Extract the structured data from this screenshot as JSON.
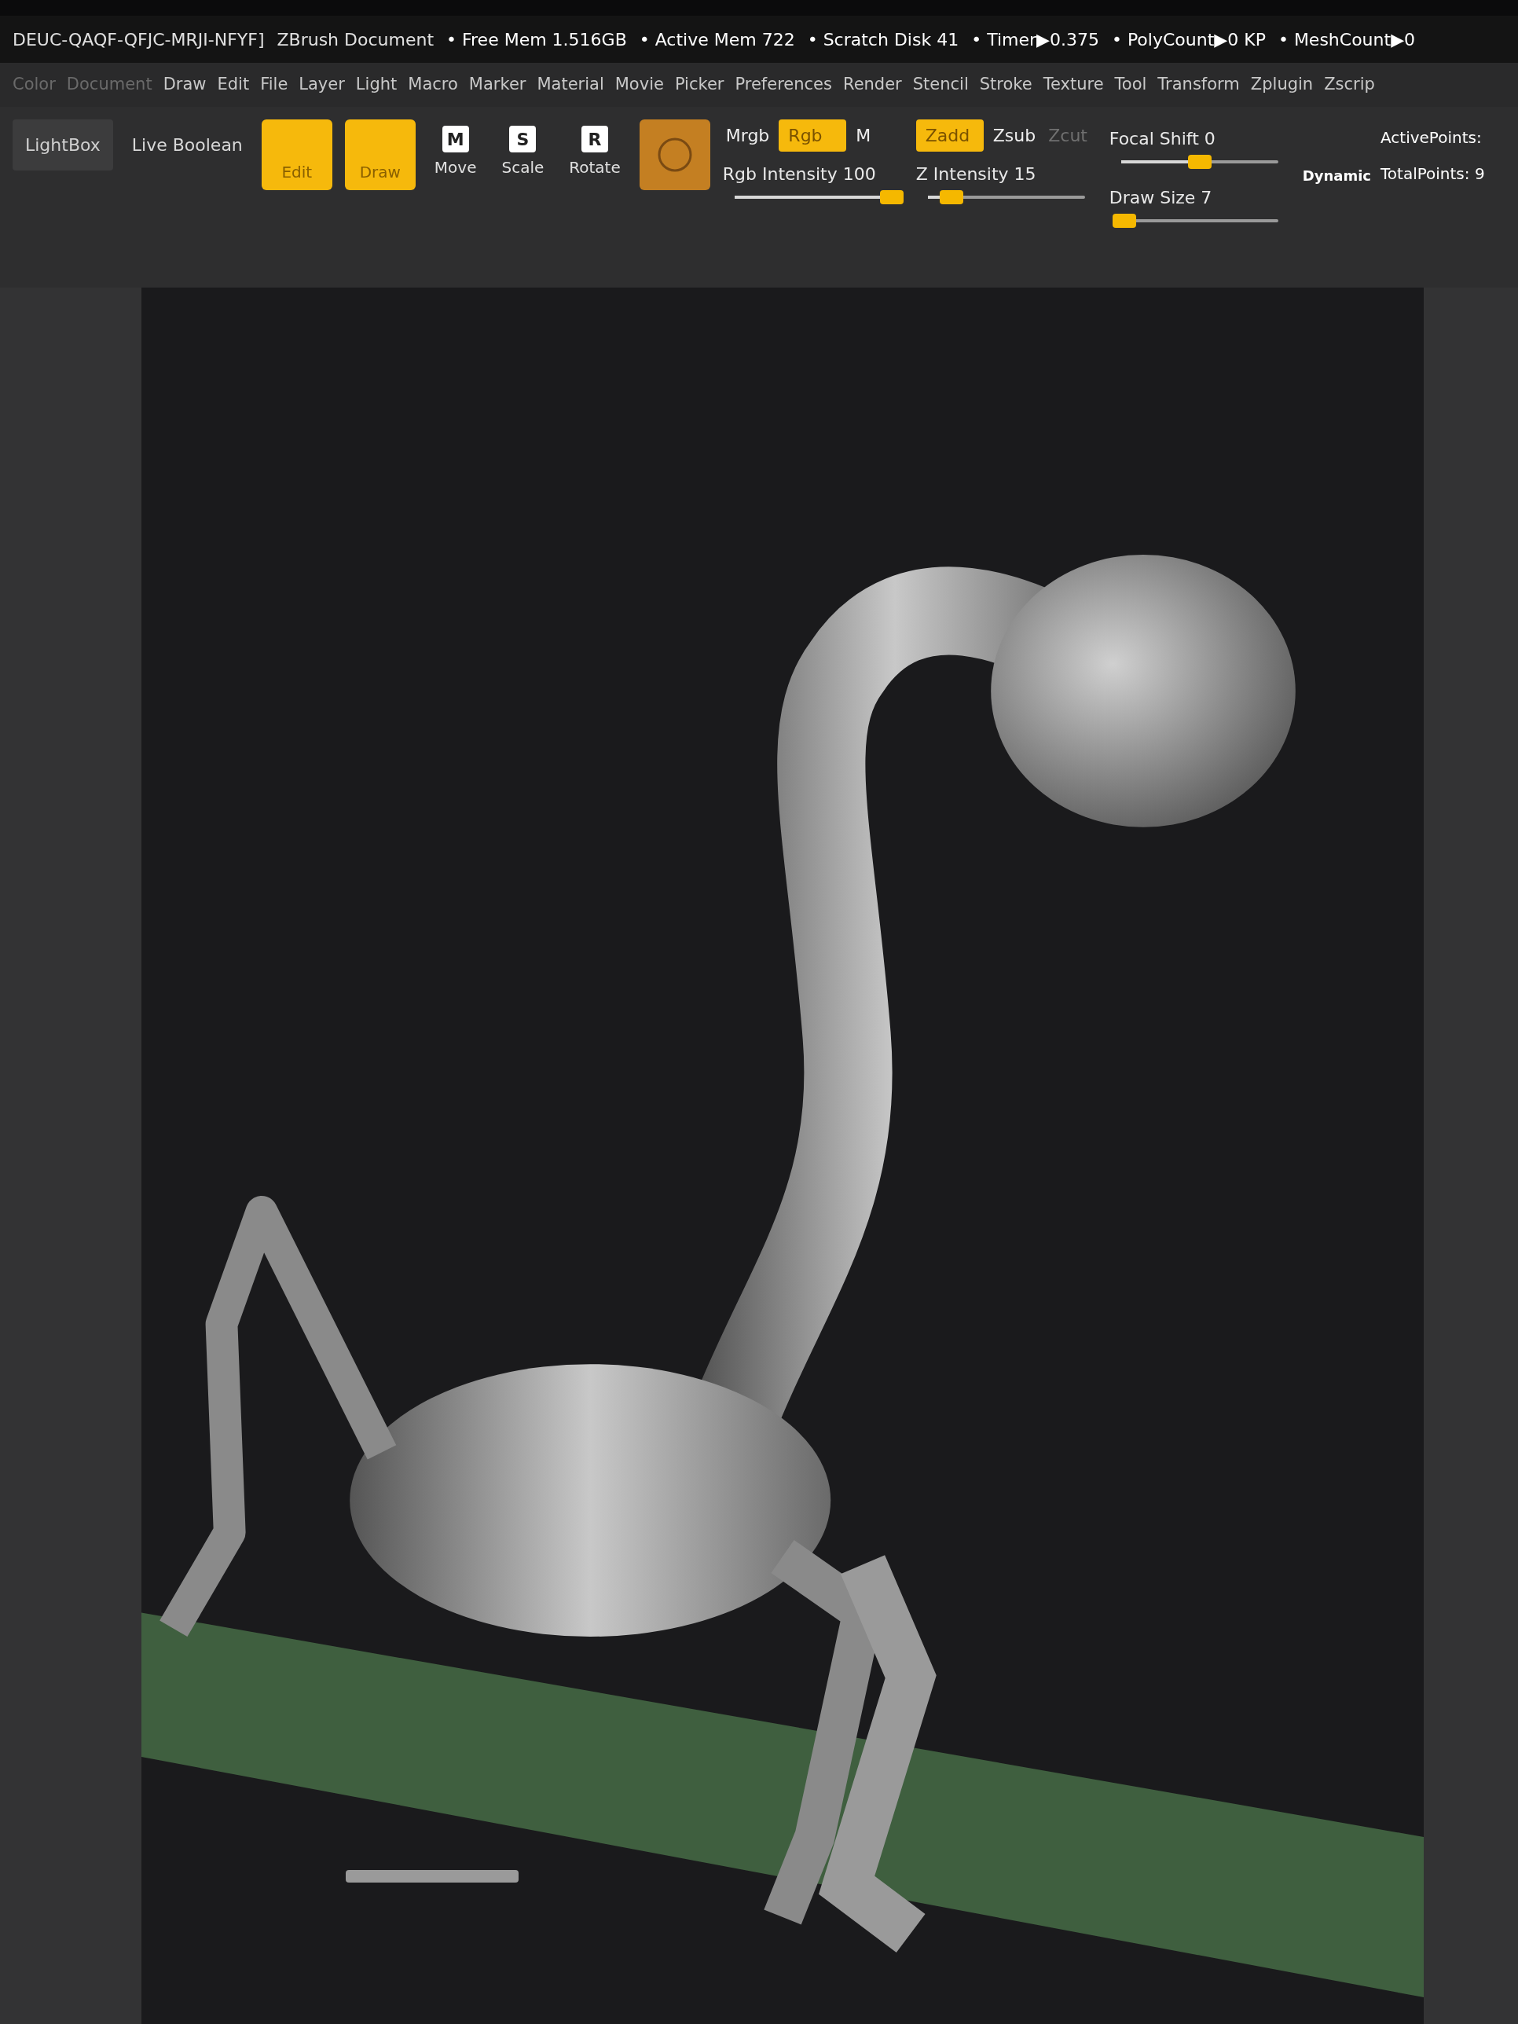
{
  "title_bar": {
    "document_id": "DEUC-QAQF-QFJC-MRJI-NFYF]",
    "app_title": "ZBrush Document",
    "stats": [
      "• Free Mem 1.516GB",
      "• Active Mem 722",
      "• Scratch Disk 41",
      "• Timer▶0.375",
      "• PolyCount▶0 KP",
      "• MeshCount▶0"
    ]
  },
  "menu": [
    {
      "label": "Color",
      "disabled": true
    },
    {
      "label": "Document",
      "disabled": true
    },
    {
      "label": "Draw",
      "disabled": false
    },
    {
      "label": "Edit",
      "disabled": false
    },
    {
      "label": "File",
      "disabled": false
    },
    {
      "label": "Layer",
      "disabled": false
    },
    {
      "label": "Light",
      "disabled": false
    },
    {
      "label": "Macro",
      "disabled": false
    },
    {
      "label": "Marker",
      "disabled": false
    },
    {
      "label": "Material",
      "disabled": false
    },
    {
      "label": "Movie",
      "disabled": false
    },
    {
      "label": "Picker",
      "disabled": false
    },
    {
      "label": "Preferences",
      "disabled": false
    },
    {
      "label": "Render",
      "disabled": false
    },
    {
      "label": "Stencil",
      "disabled": false
    },
    {
      "label": "Stroke",
      "disabled": false
    },
    {
      "label": "Texture",
      "disabled": false
    },
    {
      "label": "Tool",
      "disabled": false
    },
    {
      "label": "Transform",
      "disabled": false
    },
    {
      "label": "Zplugin",
      "disabled": false
    },
    {
      "label": "Zscrip",
      "disabled": false
    }
  ],
  "toolbar": {
    "lightbox": "LightBox",
    "live_boolean": "Live Boolean",
    "modes": [
      {
        "label": "Edit",
        "selected": true
      },
      {
        "label": "Draw",
        "selected": true
      }
    ],
    "transforms": [
      {
        "label": "Move",
        "key": "M",
        "selected": false
      },
      {
        "label": "Scale",
        "key": "S",
        "selected": false
      },
      {
        "label": "Rotate",
        "key": "R",
        "selected": false
      }
    ],
    "color_toggles": [
      {
        "label": "Mrgb",
        "selected": false,
        "disabled": false
      },
      {
        "label": "Rgb",
        "selected": true,
        "disabled": false
      },
      {
        "label": "M",
        "selected": false,
        "disabled": false
      }
    ],
    "rgb_intensity": {
      "label": "Rgb Intensity 100",
      "level": 1.0
    },
    "z_toggles": [
      {
        "label": "Zadd",
        "selected": true,
        "disabled": false
      },
      {
        "label": "Zsub",
        "selected": false,
        "disabled": false
      },
      {
        "label": "Zcut",
        "selected": false,
        "disabled": true
      }
    ],
    "z_intensity": {
      "label": "Z Intensity 15",
      "level": 0.15
    },
    "focal_shift": {
      "label": "Focal Shift 0",
      "level": 0.5
    },
    "draw_size": {
      "label": "Draw Size 7",
      "level": 0.02
    },
    "dynamic": "Dynamic",
    "points": [
      "ActivePoints:",
      "TotalPoints: 9"
    ]
  }
}
